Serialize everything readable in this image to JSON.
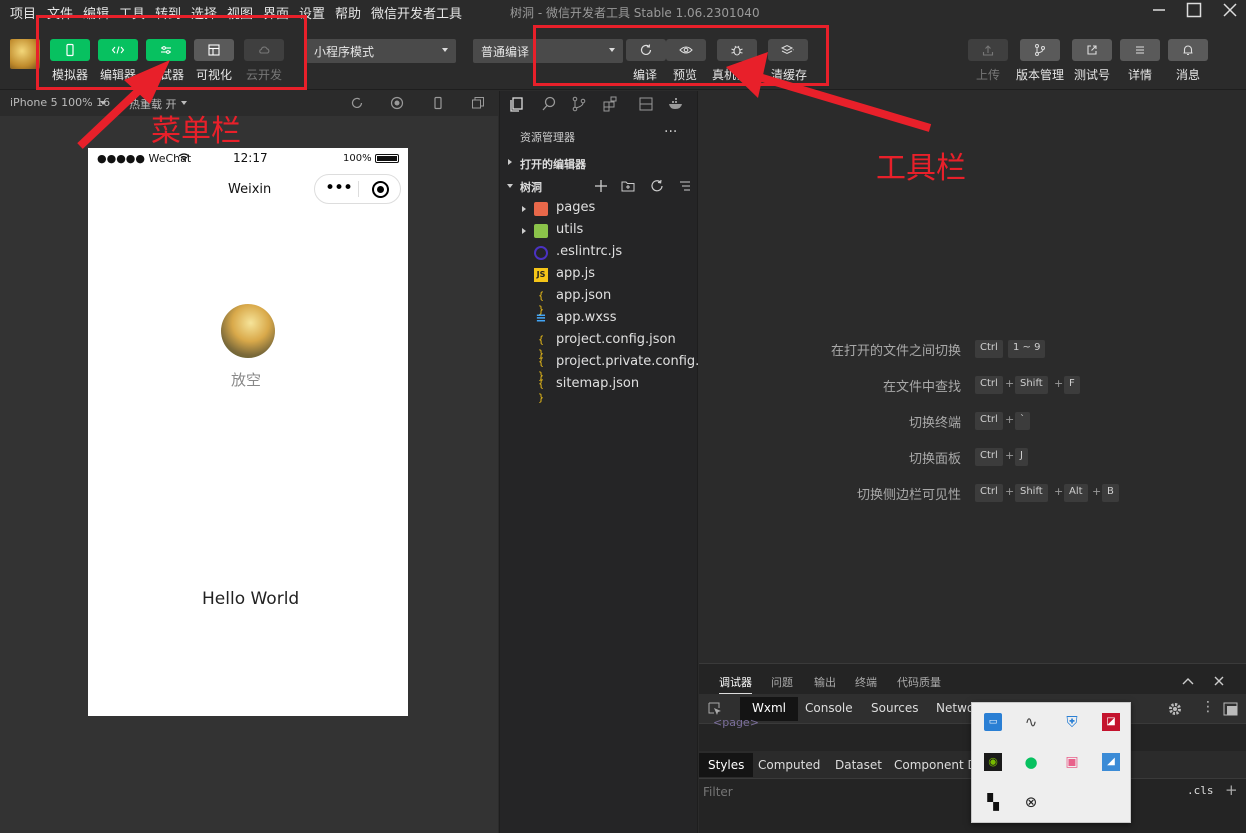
{
  "menu": [
    "项目",
    "文件",
    "编辑",
    "工具",
    "转到",
    "选择",
    "视图",
    "界面",
    "设置",
    "帮助",
    "微信开发者工具"
  ],
  "window_title": "树洞 - 微信开发者工具 Stable 1.06.2301040",
  "toolbar": {
    "left_buttons": [
      {
        "label": "模拟器",
        "icon": "phone-icon",
        "style": "green"
      },
      {
        "label": "编辑器",
        "icon": "code-icon",
        "style": "green"
      },
      {
        "label": "调试器",
        "icon": "debug-sliders-icon",
        "style": "green"
      },
      {
        "label": "可视化",
        "icon": "layout-icon",
        "style": "gray"
      },
      {
        "label": "云开发",
        "icon": "cloud-icon",
        "style": "dim"
      }
    ],
    "mode_select": "小程序模式",
    "compile_select": "普通编译",
    "actions": [
      {
        "label": "编译",
        "icon": "refresh-icon"
      },
      {
        "label": "预览",
        "icon": "eye-icon"
      },
      {
        "label": "真机调试",
        "icon": "bug-icon"
      },
      {
        "label": "清缓存",
        "icon": "layers-icon"
      }
    ],
    "right_actions": [
      {
        "label": "上传",
        "icon": "upload-icon",
        "dim": true
      },
      {
        "label": "版本管理",
        "icon": "branch-icon",
        "dim": false
      },
      {
        "label": "测试号",
        "icon": "external-icon",
        "dim": false
      },
      {
        "label": "详情",
        "icon": "menu-icon",
        "dim": false
      },
      {
        "label": "消息",
        "icon": "bell-icon",
        "dim": false
      }
    ]
  },
  "subbar": {
    "device": "iPhone 5 100% 16",
    "hot_reload": "热重载 开"
  },
  "phone": {
    "signal": "●●●●● WeChat",
    "time": "12:17",
    "battery": "100%",
    "nav_title": "Weixin",
    "capsule_dots": "•••",
    "username": "放空",
    "hello": "Hello World"
  },
  "explorer": {
    "title": "资源管理器",
    "more": "···",
    "open_editors": "打开的编辑器",
    "project": "树洞",
    "files": [
      {
        "name": "pages",
        "type": "folder",
        "color": "#e8684a"
      },
      {
        "name": "utils",
        "type": "folder",
        "color": "#8bc34a"
      },
      {
        "name": ".eslintrc.js",
        "type": "eslint",
        "color": "#4b32c3"
      },
      {
        "name": "app.js",
        "type": "js",
        "color": "#f5c518"
      },
      {
        "name": "app.json",
        "type": "json",
        "color": "#f5c518"
      },
      {
        "name": "app.wxss",
        "type": "wxss",
        "color": "#42a5f5"
      },
      {
        "name": "project.config.json",
        "type": "json",
        "color": "#f5c518"
      },
      {
        "name": "project.private.config.js...",
        "type": "json",
        "color": "#f5c518"
      },
      {
        "name": "sitemap.json",
        "type": "json",
        "color": "#f5c518"
      }
    ]
  },
  "shortcuts": [
    {
      "label": "在打开的文件之间切换",
      "keys": [
        "Ctrl",
        "1 ~ 9"
      ],
      "joiners": [
        ""
      ]
    },
    {
      "label": "在文件中查找",
      "keys": [
        "Ctrl",
        "Shift",
        "F"
      ],
      "joiners": [
        "+",
        "+"
      ]
    },
    {
      "label": "切换终端",
      "keys": [
        "Ctrl",
        "`"
      ],
      "joiners": [
        "+"
      ]
    },
    {
      "label": "切换面板",
      "keys": [
        "Ctrl",
        "J"
      ],
      "joiners": [
        "+"
      ]
    },
    {
      "label": "切换侧边栏可见性",
      "keys": [
        "Ctrl",
        "Shift",
        "Alt",
        "B"
      ],
      "joiners": [
        "+",
        "+",
        "+"
      ]
    }
  ],
  "debug": {
    "panel_tabs": [
      "调试器",
      "问题",
      "输出",
      "终端",
      "代码质量"
    ],
    "dev_tabs": [
      "Wxml",
      "Console",
      "Sources",
      "Network"
    ],
    "page_tag": "<page>",
    "style_tabs": [
      "Styles",
      "Computed",
      "Dataset",
      "Component Data"
    ],
    "filter_placeholder": "Filter",
    "cls": ".cls",
    "add": "+"
  },
  "annotations": {
    "menu_label": "菜单栏",
    "toolbar_label": "工具栏",
    "color": "#e8202a"
  }
}
